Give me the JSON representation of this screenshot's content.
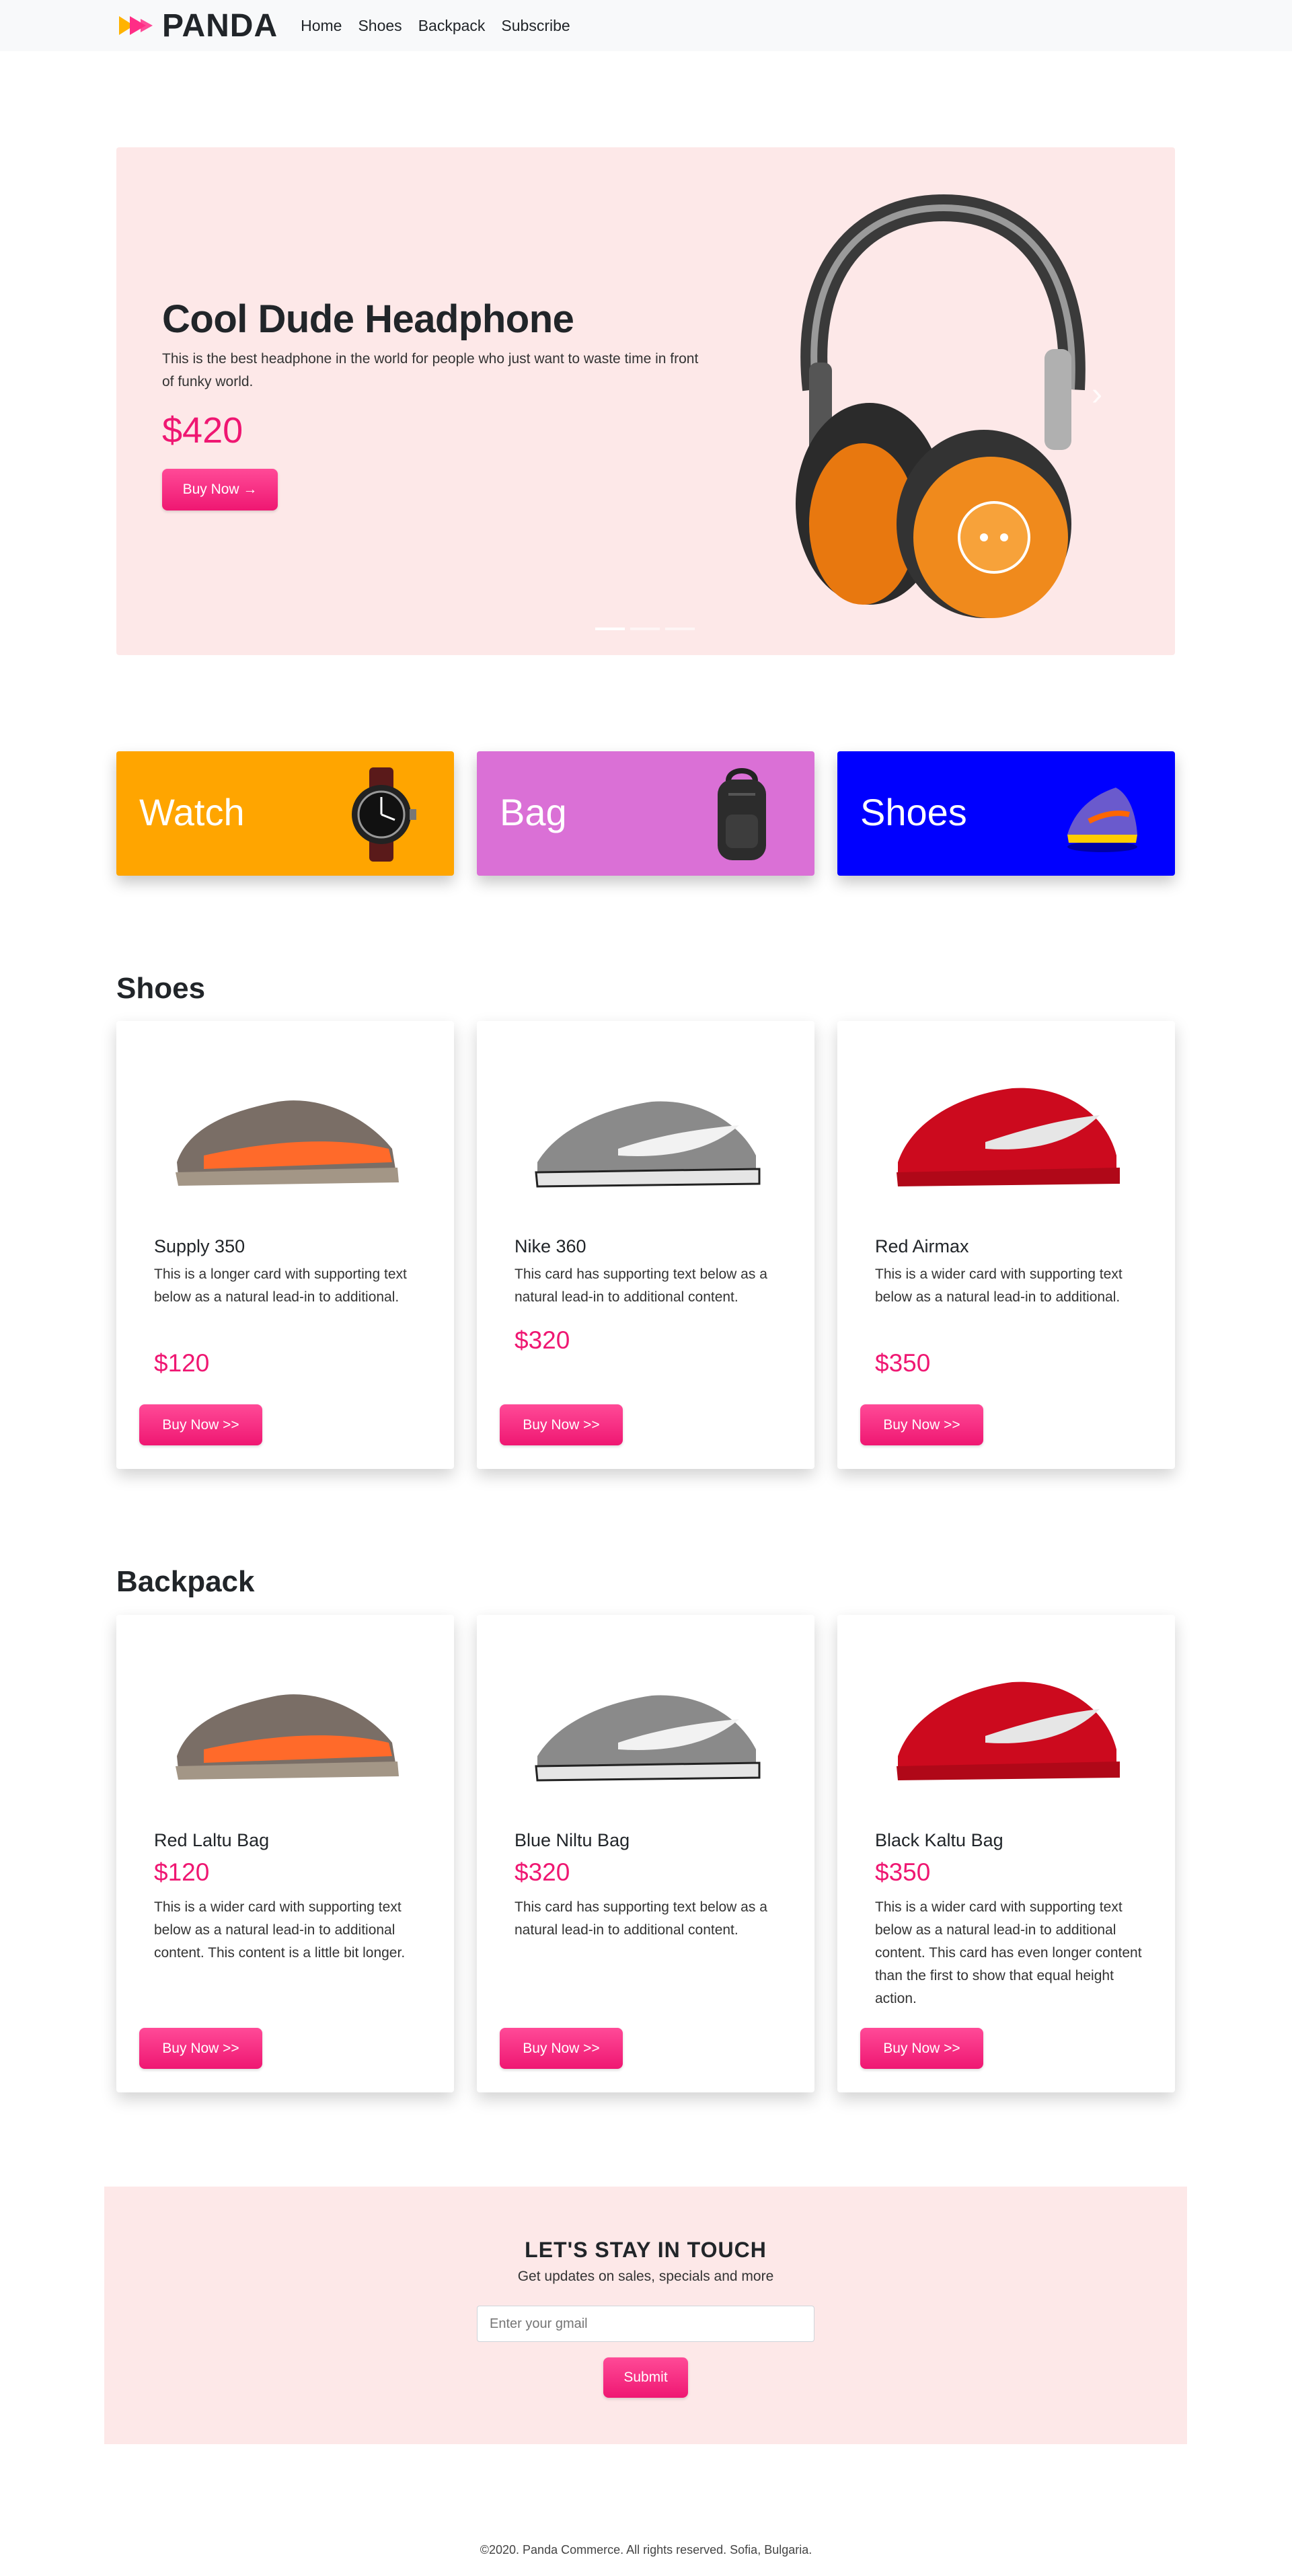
{
  "nav": {
    "brand": "PANDA",
    "links": [
      "Home",
      "Shoes",
      "Backpack",
      "Subscribe"
    ]
  },
  "hero": {
    "title": "Cool Dude Headphone",
    "description": "This is the best headphone in the world for people who just want to waste time in front of funky world.",
    "price": "$420",
    "button": "Buy Now →"
  },
  "categories": [
    {
      "label": "Watch",
      "color": "#ffa500",
      "icon": "watch-icon"
    },
    {
      "label": "Bag",
      "color": "#da70d6",
      "icon": "backpack-icon"
    },
    {
      "label": "Shoes",
      "color": "#0000ff",
      "icon": "sneaker-icon"
    }
  ],
  "shoes": {
    "title": "Shoes",
    "items": [
      {
        "name": "Supply 350",
        "description": "This is a longer card with supporting text below as a natural lead-in to additional.",
        "price": "$120",
        "button": "Buy Now >>"
      },
      {
        "name": "Nike 360",
        "description": "This card has supporting text below as a natural lead-in to additional content.",
        "price": "$320",
        "button": "Buy Now >>"
      },
      {
        "name": "Red Airmax",
        "description": "This is a wider card with supporting text below as a natural lead-in to additional.",
        "price": "$350",
        "button": "Buy Now >>"
      }
    ]
  },
  "backpack": {
    "title": "Backpack",
    "items": [
      {
        "name": "Red Laltu Bag",
        "price": "$120",
        "description": "This is a wider card with supporting text below as a natural lead-in to additional content. This content is a little bit longer.",
        "button": "Buy Now >>"
      },
      {
        "name": "Blue Niltu Bag",
        "price": "$320",
        "description": "This card has supporting text below as a natural lead-in to additional content.",
        "button": "Buy Now >>"
      },
      {
        "name": "Black Kaltu Bag",
        "price": "$350",
        "description": "This is a wider card with supporting text below as a natural lead-in to additional content. This card has even longer content than the first to show that equal height action.",
        "button": "Buy Now >>"
      }
    ]
  },
  "newsletter": {
    "title": "LET'S STAY IN TOUCH",
    "subtitle": "Get updates on sales, specials and more",
    "placeholder": "Enter your gmail",
    "button": "Submit"
  },
  "footer": "©2020. Panda Commerce. All rights reserved. Sofia, Bulgaria.",
  "colors": {
    "accent": "#ef1772",
    "hero_bg": "#fde8e8",
    "nav_bg": "#f8f9fa"
  }
}
